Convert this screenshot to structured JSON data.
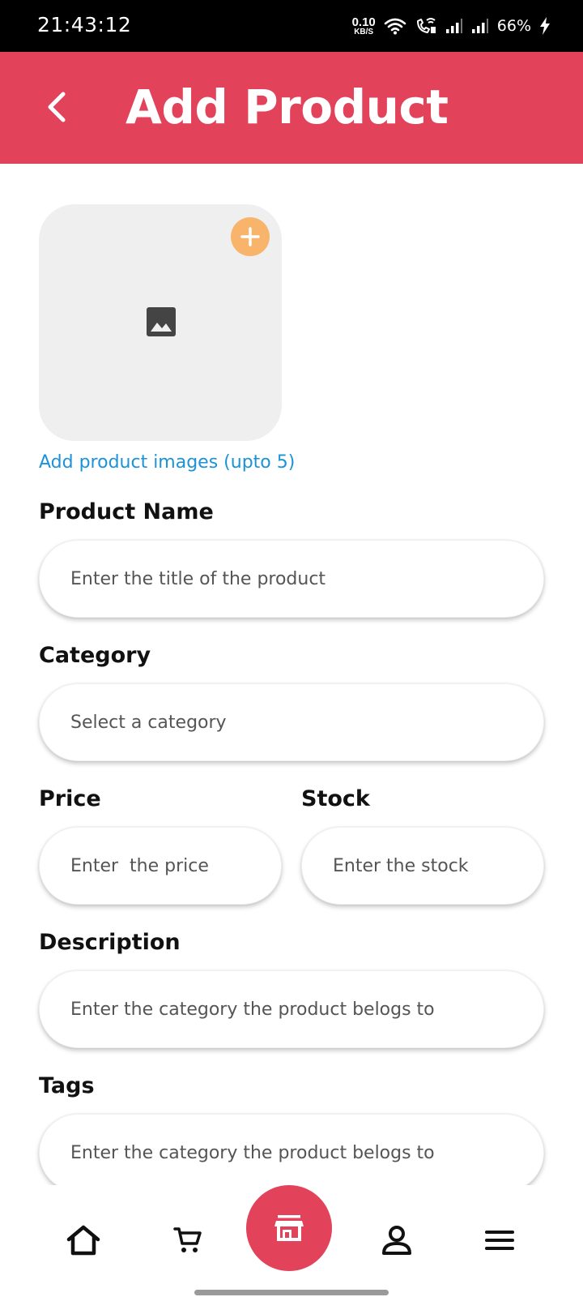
{
  "status_bar": {
    "time": "21:43:12",
    "net_speed_value": "0.10",
    "net_speed_unit": "KB/S",
    "battery": "66%"
  },
  "app_bar": {
    "title": "Add Product",
    "background_color": "#E3425B"
  },
  "image_picker": {
    "hint": "Add product images (upto 5)",
    "add_button_color": "#F8B46A"
  },
  "form": {
    "product_name": {
      "label": "Product Name",
      "placeholder": "Enter the title of the product",
      "value": ""
    },
    "category": {
      "label": "Category",
      "placeholder": "Select a category",
      "value": ""
    },
    "price": {
      "label": "Price",
      "placeholder": "Enter  the price",
      "value": ""
    },
    "stock": {
      "label": "Stock",
      "placeholder": "Enter the stock",
      "value": ""
    },
    "description": {
      "label": "Description",
      "placeholder": "Enter the category the product belogs to",
      "value": ""
    },
    "tags": {
      "label": "Tags",
      "placeholder": "Enter the category the product belogs to",
      "value": ""
    }
  },
  "bottom_nav": {
    "items": [
      {
        "icon": "home-icon"
      },
      {
        "icon": "cart-icon"
      },
      {
        "icon": "store-icon",
        "active": true
      },
      {
        "icon": "profile-icon"
      },
      {
        "icon": "menu-icon"
      }
    ]
  }
}
